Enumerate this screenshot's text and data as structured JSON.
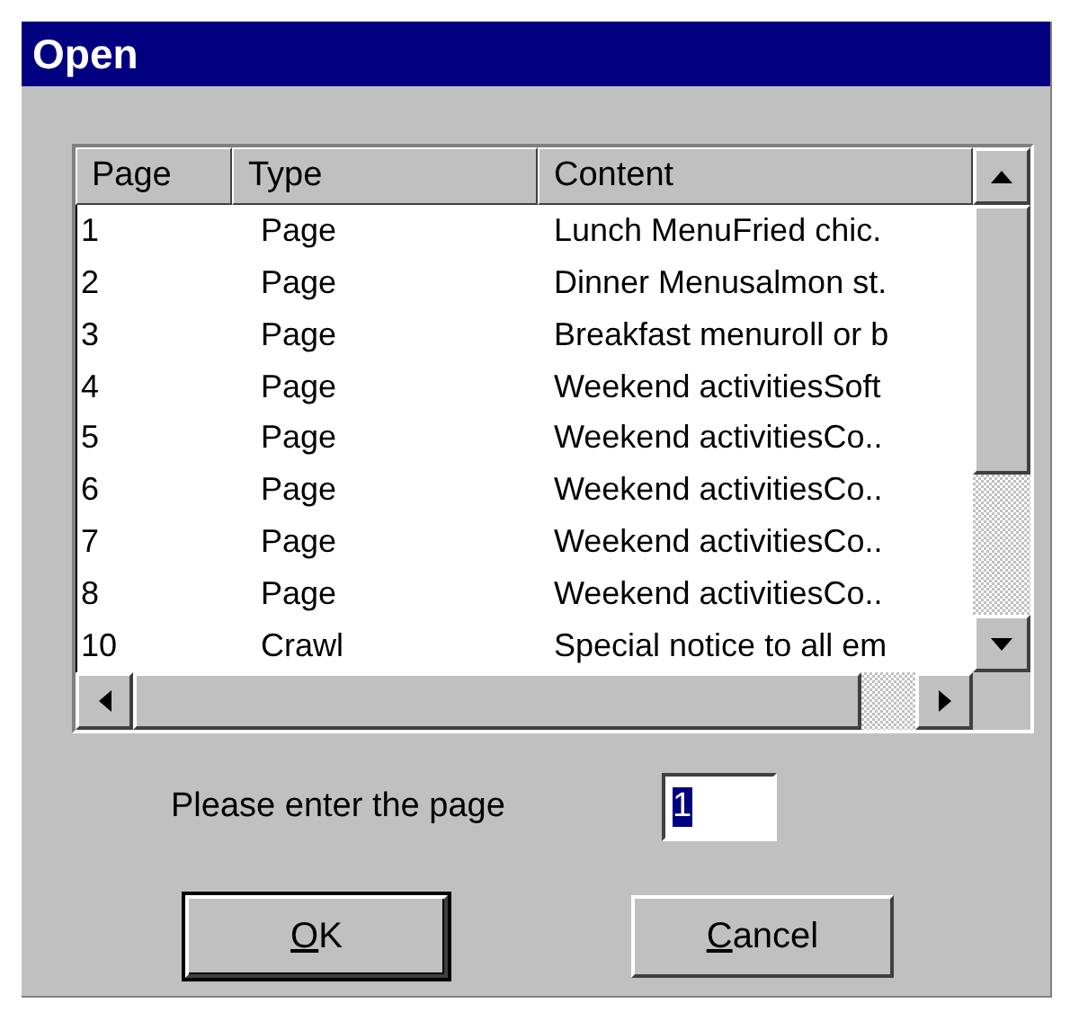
{
  "window": {
    "title": "Open"
  },
  "table": {
    "columns": [
      "Page",
      "Type",
      "Content"
    ],
    "rows": [
      {
        "cells": [
          "1",
          "Page",
          "Lunch MenuFried chic."
        ]
      },
      {
        "cells": [
          "2",
          "Page",
          "Dinner Menusalmon st."
        ]
      },
      {
        "cells": [
          "3",
          "Page",
          "Breakfast menuroll or b"
        ]
      },
      {
        "cells": [
          "4",
          "Page",
          "Weekend activitiesSoft"
        ]
      },
      {
        "cells": [
          "5",
          "Page",
          "Weekend activitiesCo.."
        ]
      },
      {
        "cells": [
          "6",
          "Page",
          "Weekend activitiesCo.."
        ]
      },
      {
        "cells": [
          "7",
          "Page",
          "Weekend activitiesCo.."
        ]
      },
      {
        "cells": [
          "8",
          "Page",
          "Weekend activitiesCo.."
        ]
      },
      {
        "cells": [
          "10",
          "Crawl",
          "Special notice to all em"
        ]
      }
    ]
  },
  "page_field": {
    "label": "Please enter the page",
    "value": "1",
    "value_selected": true
  },
  "buttons": [
    {
      "access_key": "O",
      "rest": "K",
      "default": true
    },
    {
      "access_key": "C",
      "rest": "ancel",
      "default": false
    }
  ]
}
